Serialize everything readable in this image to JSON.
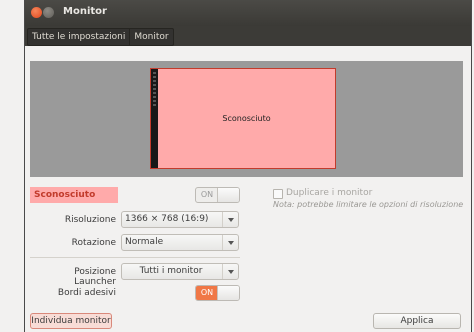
{
  "window": {
    "title": "Monitor"
  },
  "breadcrumbs": [
    "Tutte le impostazioni",
    "Monitor"
  ],
  "display": {
    "monitor_label": "Sconosciuto"
  },
  "monitor_name": "Sconosciuto",
  "monitor_switch": "ON",
  "mirror": {
    "label": "Duplicare i monitor",
    "checked": false,
    "note": "Nota: potrebbe limitare le opzioni di risoluzione"
  },
  "settings": {
    "resolution_label": "Risoluzione",
    "resolution_value": "1366 × 768 (16:9)",
    "rotation_label": "Rotazione",
    "rotation_value": "Normale",
    "launcher_label": "Posizione Launcher",
    "launcher_value": "Tutti i monitor",
    "sticky_label": "Bordi adesivi",
    "sticky_value": "ON"
  },
  "buttons": {
    "detect": "Individua monitor",
    "apply": "Applica"
  },
  "colors": {
    "accent": "#f07746",
    "monitor_fill": "#ffaaaa",
    "monitor_border": "#c23b2c",
    "titlebar": "#3c3b37"
  }
}
